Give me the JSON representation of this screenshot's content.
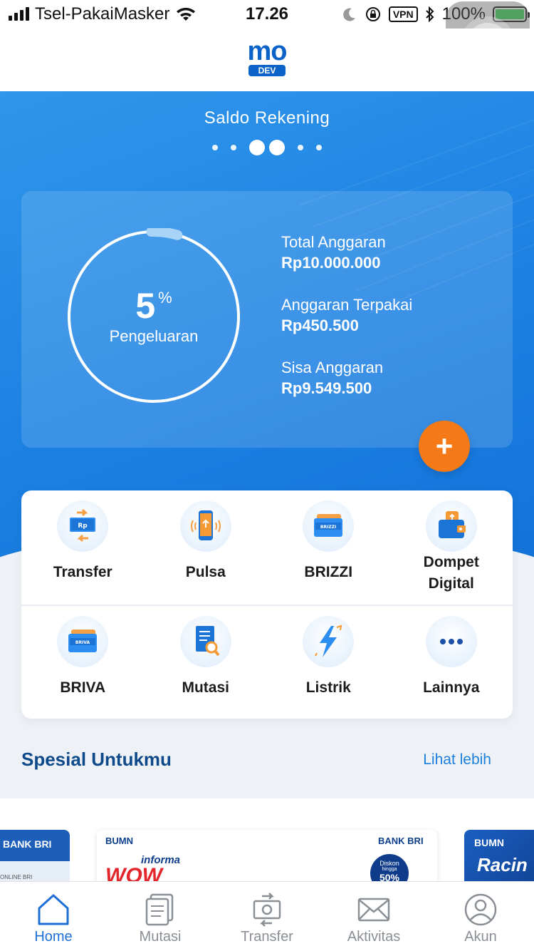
{
  "status_bar": {
    "carrier": "Tsel-PakaiMasker",
    "time": "17.26",
    "vpn": "VPN",
    "battery": "100%"
  },
  "header": {
    "logo_text": "mo",
    "logo_badge": "DEV"
  },
  "hero": {
    "title": "Saldo Rekening",
    "budget": {
      "percent": "5",
      "percent_sign": "%",
      "percent_label": "Pengeluaran",
      "progress_fraction": 0.05,
      "total_label": "Total Anggaran",
      "total_value": "Rp10.000.000",
      "used_label": "Anggaran Terpakai",
      "used_value": "Rp450.500",
      "remaining_label": "Sisa Anggaran",
      "remaining_value": "Rp9.549.500"
    },
    "add_button": "+"
  },
  "menu": {
    "row1": [
      {
        "label": "Transfer",
        "icon": "transfer-icon"
      },
      {
        "label": "Pulsa",
        "icon": "phone-icon"
      },
      {
        "label": "BRIZZI",
        "icon": "brizzi-card-icon"
      },
      {
        "label": "Dompet Digital",
        "icon": "wallet-icon"
      }
    ],
    "row2": [
      {
        "label": "BRIVA",
        "icon": "briva-card-icon"
      },
      {
        "label": "Mutasi",
        "icon": "document-search-icon"
      },
      {
        "label": "Listrik",
        "icon": "lightning-icon"
      },
      {
        "label": "Lainnya",
        "icon": "more-icon"
      }
    ]
  },
  "special": {
    "title": "Spesial Untukmu",
    "see_more": "Lihat lebih"
  },
  "promos": {
    "p1_brand": "BANK BRI",
    "p1_sub": "ONLINE BRI",
    "p2_brand_left": "BUMN",
    "p2_brand_right": "BANK BRI",
    "p2_partner": "informa",
    "p2_headline": "WOW",
    "p2_discount_label": "Diskon",
    "p2_discount_sub": "hingga",
    "p2_discount_value": "50%",
    "p3_brand": "BUMN",
    "p3_text": "Racin"
  },
  "bottom_nav": [
    {
      "label": "Home",
      "icon": "home-icon",
      "active": true
    },
    {
      "label": "Mutasi",
      "icon": "mutation-doc-icon",
      "active": false
    },
    {
      "label": "Transfer",
      "icon": "transfer-money-icon",
      "active": false
    },
    {
      "label": "Aktivitas",
      "icon": "envelope-icon",
      "active": false
    },
    {
      "label": "Akun",
      "icon": "user-icon",
      "active": false
    }
  ],
  "colors": {
    "primary": "#1c80e2",
    "accent_orange": "#f57a17",
    "title_navy": "#0e4a8a",
    "nav_active": "#1d6fd6"
  }
}
